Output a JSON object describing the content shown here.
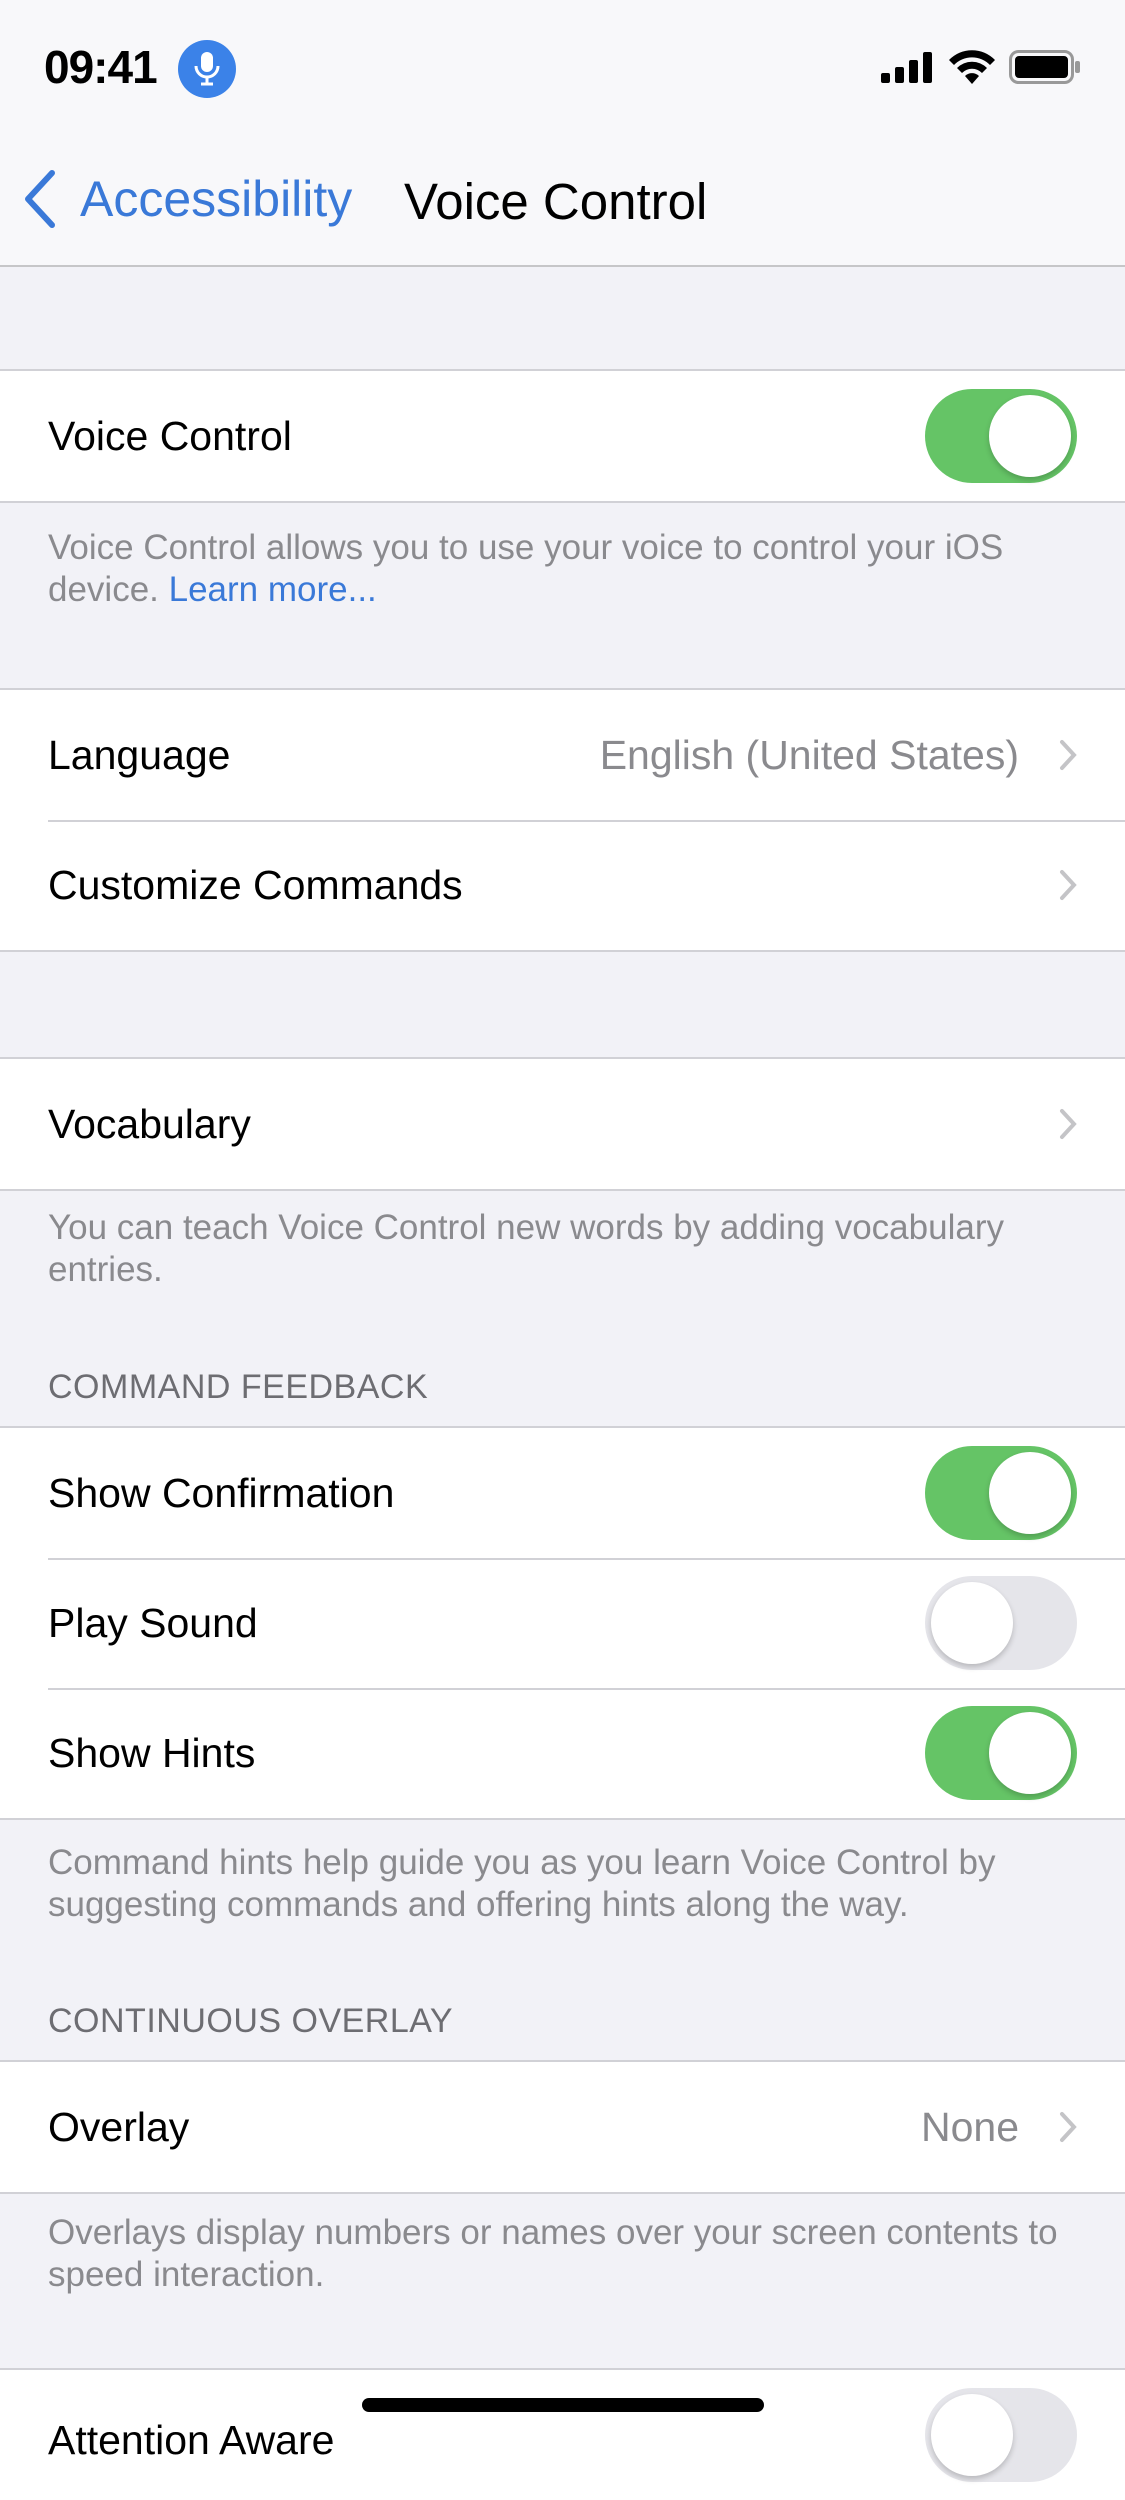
{
  "status_bar": {
    "time": "09:41",
    "mic_icon": "microphone-icon",
    "signal_icon": "cellular-signal-icon",
    "wifi_icon": "wifi-icon",
    "battery_icon": "battery-icon"
  },
  "nav": {
    "back_label": "Accessibility",
    "title": "Voice Control"
  },
  "voice_control": {
    "label": "Voice Control",
    "enabled": true
  },
  "voice_control_footer": {
    "text": "Voice Control allows you to use your voice to control your iOS device. ",
    "link": "Learn more..."
  },
  "language_group": {
    "language_label": "Language",
    "language_value": "English (United States)",
    "customize_label": "Customize Commands"
  },
  "vocabulary": {
    "label": "Vocabulary",
    "footer": "You can teach Voice Control new words by adding vocabulary entries."
  },
  "command_feedback": {
    "header": "COMMAND FEEDBACK",
    "items": [
      {
        "label": "Show Confirmation",
        "enabled": true
      },
      {
        "label": "Play Sound",
        "enabled": false
      },
      {
        "label": "Show Hints",
        "enabled": true
      }
    ],
    "footer": "Command hints help guide you as you learn Voice Control by suggesting commands and offering hints along the way."
  },
  "continuous_overlay": {
    "header": "CONTINUOUS OVERLAY",
    "overlay_label": "Overlay",
    "overlay_value": "None",
    "footer": "Overlays display numbers or names over your screen contents to speed interaction."
  },
  "attention_aware": {
    "label": "Attention Aware",
    "enabled": false
  },
  "colors": {
    "accent": "#3a79d8",
    "toggle_on": "#65c466",
    "toggle_off": "#e5e5ea",
    "background": "#f2f2f7"
  }
}
